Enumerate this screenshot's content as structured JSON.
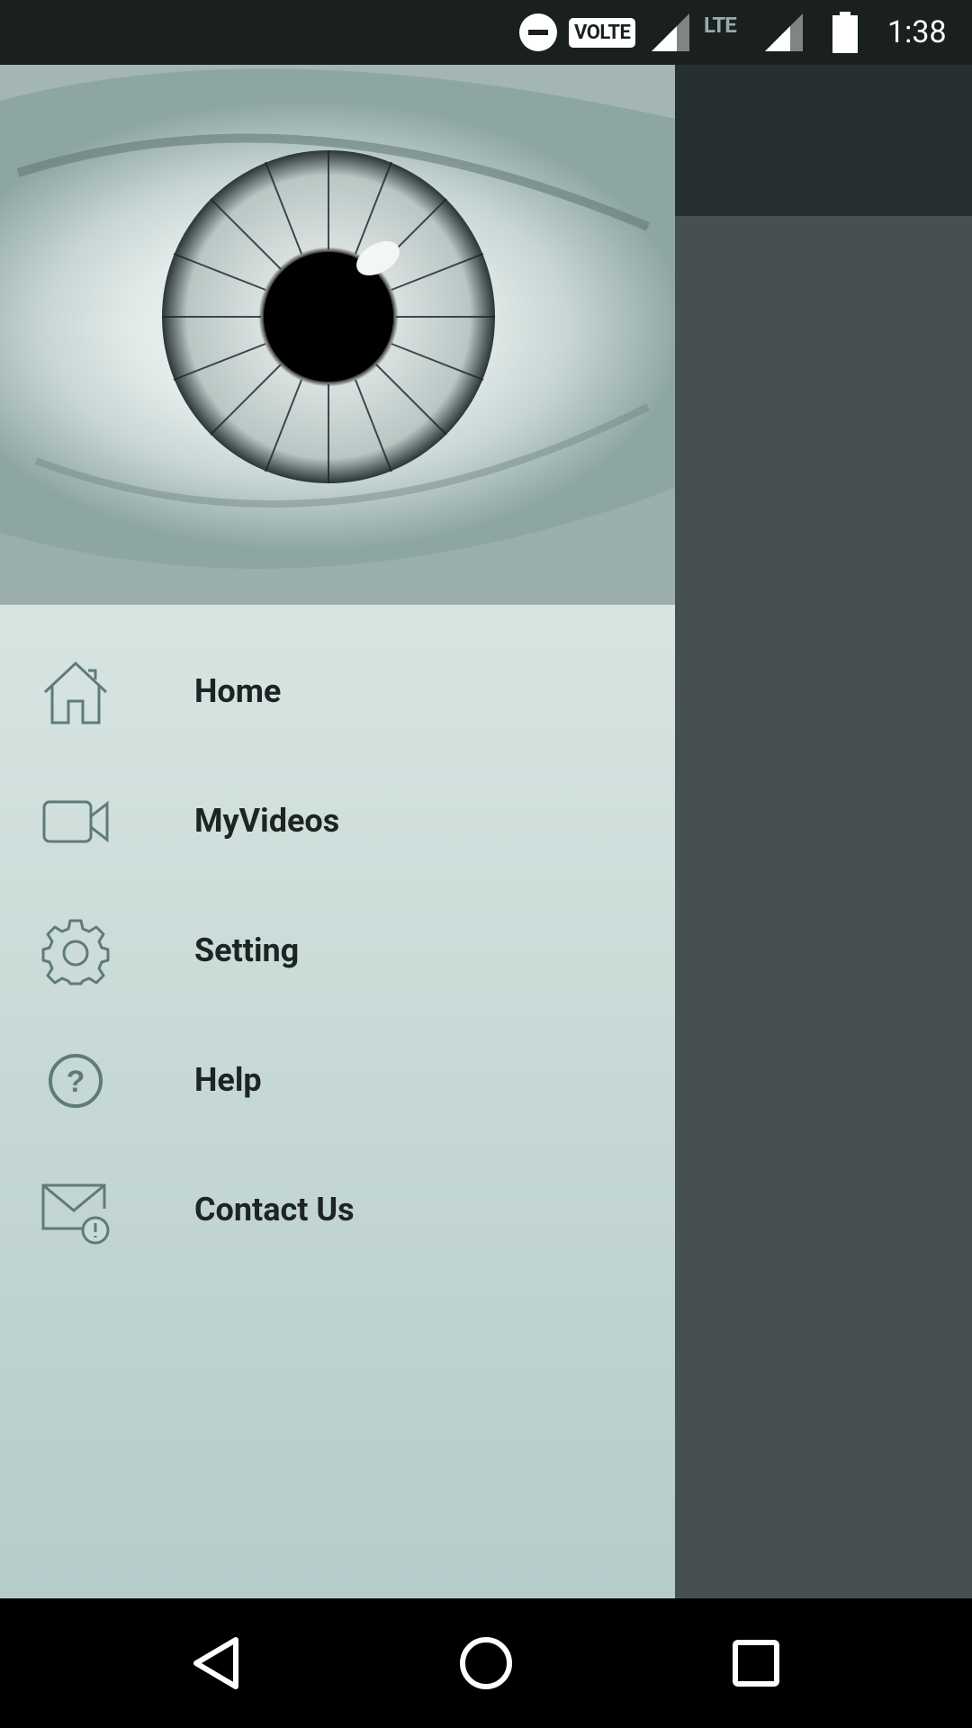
{
  "status_bar": {
    "volte_label": "VOLTE",
    "lte_label": "LTE",
    "time": "1:38",
    "icons": [
      "do-not-disturb-icon",
      "volte-icon",
      "signal-icon",
      "lte-disabled-icon",
      "signal-icon",
      "battery-icon"
    ]
  },
  "drawer": {
    "header_image": "eye-image",
    "items": [
      {
        "label": "Home",
        "icon": "home-icon"
      },
      {
        "label": "MyVideos",
        "icon": "video-camera-icon"
      },
      {
        "label": "Setting",
        "icon": "gear-icon"
      },
      {
        "label": "Help",
        "icon": "help-icon"
      },
      {
        "label": "Contact Us",
        "icon": "mail-alert-icon"
      }
    ]
  },
  "nav_bar": {
    "icons": [
      "back-icon",
      "home-circle-icon",
      "recents-icon"
    ]
  },
  "colors": {
    "status_bar_bg": "#1a2020",
    "scrim": "#475050",
    "toolbar": "#263030",
    "drawer_top": "#d3e5e8",
    "drawer_bottom": "#b6cccb",
    "icon_stroke": "#5f7b79",
    "label_text": "#1d2424"
  }
}
